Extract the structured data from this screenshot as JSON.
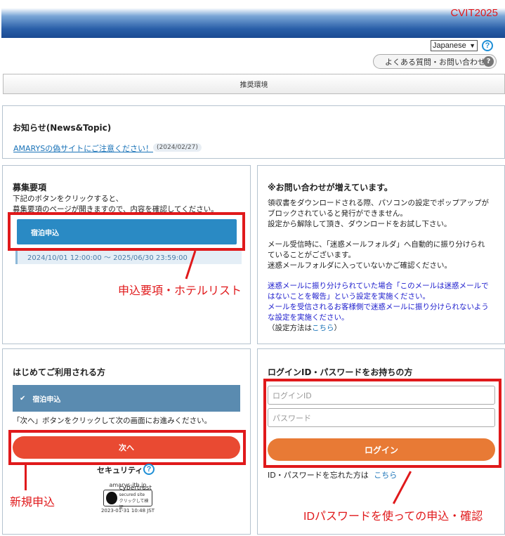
{
  "header": {
    "brand": "CVIT2025"
  },
  "lang": {
    "selected": "Japanese"
  },
  "faq_label": "よくある質問・お問い合わせ",
  "env_label": "推奨環境",
  "news": {
    "title": "お知らせ(News&Topic)",
    "link": "AMARYSの偽サイトにご注意ください！",
    "date": "(2024/02/27)"
  },
  "recruit": {
    "title": "募集要項",
    "desc1": "下記のボタンをクリックすると、",
    "desc2": "募集要項のページが開きますので、内容を確認してください。",
    "button": "宿泊申込",
    "period": "2024/10/01 12:00:00 ～ 2025/06/30 23:59:00"
  },
  "notice": {
    "title": "※お問い合わせが増えています。",
    "p1": [
      "領収書をダウンロードされる際、パソコンの設定でポップアップが",
      "ブロックされていると発行ができません。",
      "設定から解除して頂き、ダウンロードをお試し下さい。"
    ],
    "p2": [
      "メール受信時に、「迷惑メールフォルダ」へ自動的に振り分けられ",
      "ていることがございます。",
      "迷惑メールフォルダに入っていないかご確認ください。"
    ],
    "p3": [
      "迷惑メールに振り分けられていた場合「このメールは迷惑メールで",
      "はないことを報告」という設定を実施ください。",
      "メールを受信されるお客様側で迷惑メールに振り分けられないよう",
      "な設定を実施ください。"
    ],
    "how_prefix": "（設定方法は",
    "how_link": "こちら",
    "how_suffix": "）"
  },
  "first": {
    "title": "はじめてご利用される方",
    "option": "宿泊申込",
    "instruction": "「次へ」ボタンをクリックして次の画面にお進みください。",
    "next": "次へ",
    "security": "セキュリティ",
    "seal_domain": "amarys-jtb.jp",
    "seal_name": "cybertrust",
    "seal_sub": "secured site",
    "seal_click": "クリックして検証",
    "seal_time": "2023-01-31 10:48 JST"
  },
  "login": {
    "title": "ログインID・パスワードをお持ちの方",
    "id_placeholder": "ログインID",
    "pw_placeholder": "パスワード",
    "button": "ログイン",
    "forgot": "ID・パスワードを忘れた方は",
    "forgot_link": "こちら"
  },
  "annotations": {
    "recruit": "申込要項・ホテルリスト",
    "new": "新規申込",
    "id": "IDパスワードを使っての申込・確認"
  }
}
